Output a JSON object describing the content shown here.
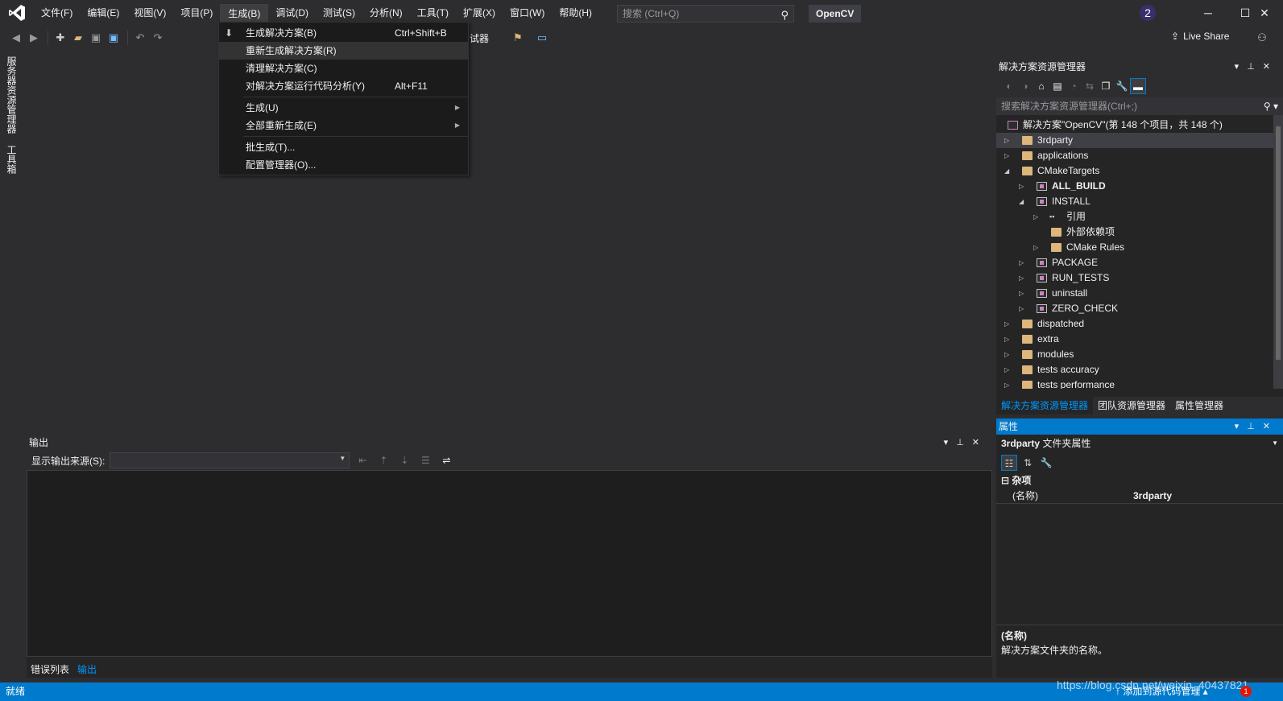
{
  "titlebar": {
    "menu": [
      "文件(F)",
      "编辑(E)",
      "视图(V)",
      "项目(P)",
      "生成(B)",
      "调试(D)",
      "测试(S)",
      "分析(N)",
      "工具(T)",
      "扩展(X)",
      "窗口(W)",
      "帮助(H)"
    ],
    "search_placeholder": "搜索 (Ctrl+Q)",
    "solution_name": "OpenCV",
    "avatar_text": "2",
    "minimize": "─",
    "maximize": "☐",
    "close": "✕"
  },
  "toolbar": {
    "partial_text": "试器",
    "live_share": "Live Share"
  },
  "left_tabs": [
    "服务器资源管理器",
    "工具箱"
  ],
  "build_menu": {
    "items": [
      {
        "label": "生成解决方案(B)",
        "shortcut": "Ctrl+Shift+B"
      },
      {
        "label": "重新生成解决方案(R)",
        "shortcut": ""
      },
      {
        "label": "清理解决方案(C)",
        "shortcut": ""
      },
      {
        "label": "对解决方案运行代码分析(Y)",
        "shortcut": "Alt+F11"
      },
      {
        "label": "生成(U)",
        "shortcut": ""
      },
      {
        "label": "全部重新生成(E)",
        "shortcut": ""
      },
      {
        "label": "批生成(T)...",
        "shortcut": ""
      },
      {
        "label": "配置管理器(O)...",
        "shortcut": ""
      }
    ]
  },
  "solution_explorer": {
    "title": "解决方案资源管理器",
    "search_placeholder": "搜索解决方案资源管理器(Ctrl+;)",
    "tree": [
      {
        "label": "解决方案\"OpenCV\"(第 148 个项目，共 148 个)"
      },
      {
        "label": "3rdparty"
      },
      {
        "label": "applications"
      },
      {
        "label": "CMakeTargets"
      },
      {
        "label": "ALL_BUILD"
      },
      {
        "label": "INSTALL"
      },
      {
        "label": "引用"
      },
      {
        "label": "外部依赖项"
      },
      {
        "label": "CMake Rules"
      },
      {
        "label": "PACKAGE"
      },
      {
        "label": "RUN_TESTS"
      },
      {
        "label": "uninstall"
      },
      {
        "label": "ZERO_CHECK"
      },
      {
        "label": "dispatched"
      },
      {
        "label": "extra"
      },
      {
        "label": "modules"
      },
      {
        "label": "tests accuracy"
      },
      {
        "label": "tests performance"
      }
    ],
    "tabs": [
      "解决方案资源管理器",
      "团队资源管理器",
      "属性管理器"
    ]
  },
  "properties": {
    "title": "属性",
    "object_name": "3rdparty",
    "object_type": "文件夹属性",
    "category": "杂项",
    "rows": [
      {
        "key": "(名称)",
        "value": "3rdparty"
      }
    ],
    "desc_title": "(名称)",
    "desc_text": "解决方案文件夹的名称。"
  },
  "output": {
    "title": "输出",
    "source_label": "显示输出来源(S):",
    "tabs": [
      "错误列表",
      "输出"
    ]
  },
  "statusbar": {
    "left": "就绪",
    "right": "↑ 添加到源代码管理 ▴",
    "watermark": "https://blog.csdn.net/weixin_40437821",
    "notification_count": "1"
  }
}
